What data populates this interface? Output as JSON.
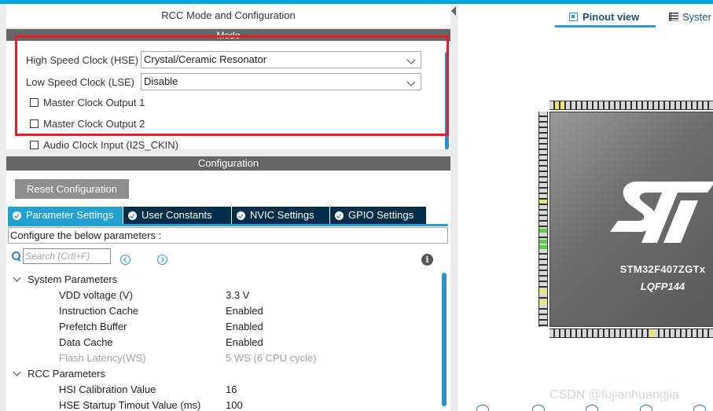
{
  "left_panel": {
    "title": "RCC Mode and Configuration",
    "mode": {
      "header": "Mode",
      "hse": {
        "label": "High Speed Clock (HSE)",
        "value": "Crystal/Ceramic Resonator"
      },
      "lse": {
        "label": "Low Speed Clock (LSE)",
        "value": "Disable"
      },
      "checkboxes": [
        {
          "label": "Master Clock Output 1",
          "checked": false
        },
        {
          "label": "Master Clock Output 2",
          "checked": false
        },
        {
          "label": "Audio Clock Input (I2S_CKIN)",
          "checked": false
        }
      ],
      "highlight_color": "#e21d25"
    },
    "configuration": {
      "header": "Configuration",
      "reset_button": "Reset Configuration",
      "tabs": [
        {
          "label": "Parameter Settings",
          "active": true
        },
        {
          "label": "User Constants",
          "active": false
        },
        {
          "label": "NVIC Settings",
          "active": false
        },
        {
          "label": "GPIO Settings",
          "active": false
        }
      ],
      "description": "Configure the below parameters :",
      "search_placeholder": "Search (Crtl+F)",
      "groups": [
        {
          "name": "System Parameters",
          "params": [
            {
              "name": "VDD voltage (V)",
              "value": "3.3 V",
              "enabled": true
            },
            {
              "name": "Instruction Cache",
              "value": "Enabled",
              "enabled": true
            },
            {
              "name": "Prefetch Buffer",
              "value": "Enabled",
              "enabled": true
            },
            {
              "name": "Data Cache",
              "value": "Enabled",
              "enabled": true
            },
            {
              "name": "Flash Latency(WS)",
              "value": "5 WS (6 CPU cycle)",
              "enabled": false
            }
          ]
        },
        {
          "name": "RCC Parameters",
          "params": [
            {
              "name": "HSI Calibration Value",
              "value": "16",
              "enabled": true
            },
            {
              "name": "HSE Startup Timout Value (ms)",
              "value": "100",
              "enabled": true
            }
          ]
        }
      ]
    }
  },
  "right_panel": {
    "tabs": [
      {
        "label": "Pinout view",
        "icon": "chip-icon",
        "active": true
      },
      {
        "label": "Syster",
        "icon": "list-icon",
        "active": false
      }
    ],
    "chip": {
      "name": "STM32F407ZGTx",
      "package": "LQFP144"
    }
  },
  "watermark": "CSDN @fujianhuangjia",
  "colors": {
    "accent": "#21a0d2",
    "tab_dark": "#002f4c",
    "header_gray": "#666666",
    "highlight": "#e21d25"
  }
}
